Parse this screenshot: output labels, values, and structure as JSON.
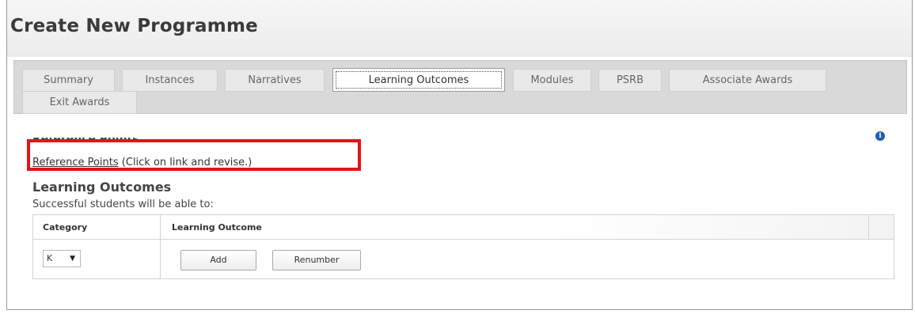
{
  "page": {
    "title": "Create New Programme"
  },
  "tabs": [
    {
      "label": "Summary",
      "active": false
    },
    {
      "label": "Instances",
      "active": false
    },
    {
      "label": "Narratives",
      "active": false
    },
    {
      "label": "Learning Outcomes",
      "active": true
    },
    {
      "label": "Modules",
      "active": false
    },
    {
      "label": "PSRB",
      "active": false
    },
    {
      "label": "Associate Awards",
      "active": false
    },
    {
      "label": "Exit Awards",
      "active": false
    }
  ],
  "info_icon": {
    "glyph": "i",
    "icon": "info-icon",
    "color": "#1e5db5"
  },
  "reference_points": {
    "heading": "Reference Points",
    "link_text": "Reference Points",
    "note": " (Click on link and revise.)",
    "highlight_color": "#e3131b"
  },
  "learning_outcomes": {
    "heading": "Learning Outcomes",
    "subtitle": "Successful students will be able to:",
    "columns": [
      "Category",
      "Learning Outcome"
    ],
    "category_select": {
      "value": "K",
      "caret": "▼"
    },
    "buttons": {
      "add": "Add",
      "renumber": "Renumber"
    }
  }
}
